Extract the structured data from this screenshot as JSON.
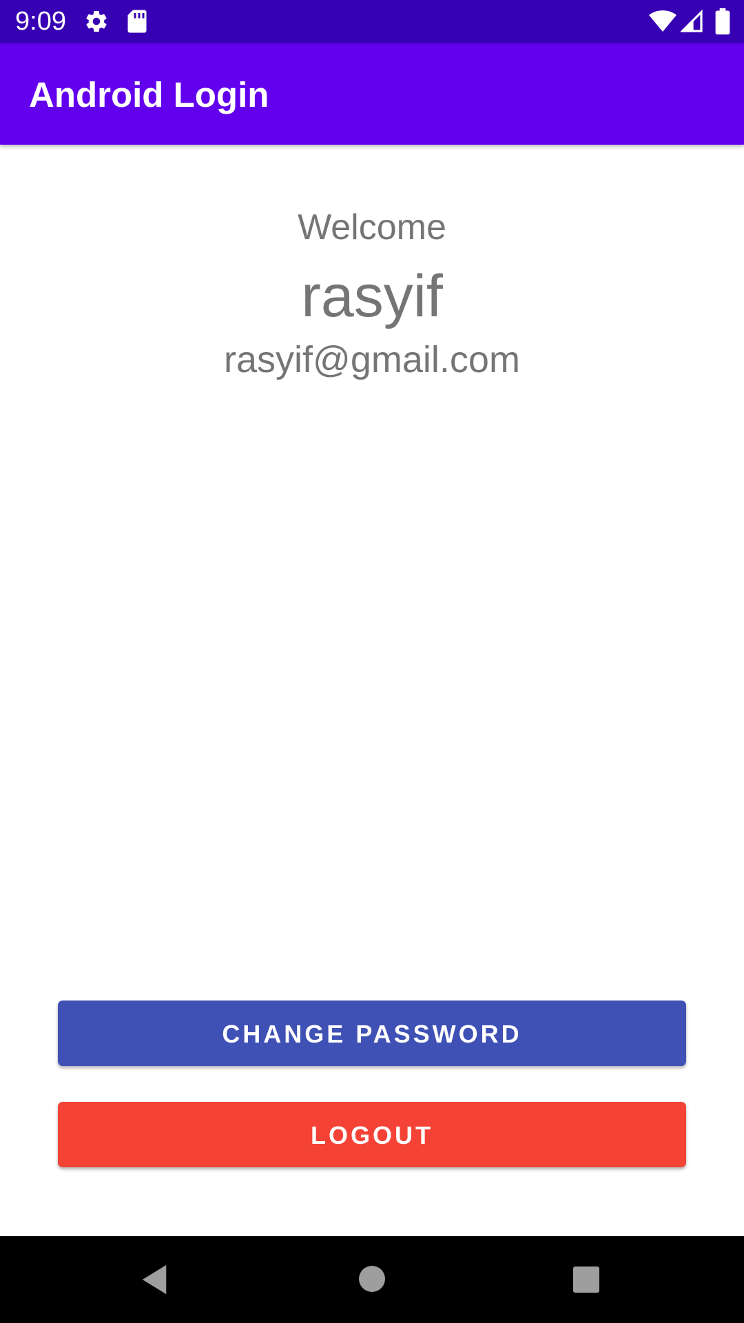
{
  "status_bar": {
    "time": "9:09",
    "icons": [
      "gear-icon",
      "sd-card-icon",
      "wifi-icon",
      "signal-icon",
      "battery-icon"
    ],
    "background_color": "#3700B3"
  },
  "app_bar": {
    "title": "Android Login",
    "background_color": "#6200EE"
  },
  "profile": {
    "welcome_label": "Welcome",
    "username": "rasyif",
    "email": "rasyif@gmail.com",
    "text_color": "#757575"
  },
  "actions": {
    "change_password_label": "CHANGE PASSWORD",
    "change_password_color": "#3F51B5",
    "logout_label": "LOGOUT",
    "logout_color": "#F44336"
  },
  "nav_bar": {
    "icons": [
      "back-icon",
      "home-icon",
      "recents-icon"
    ]
  }
}
